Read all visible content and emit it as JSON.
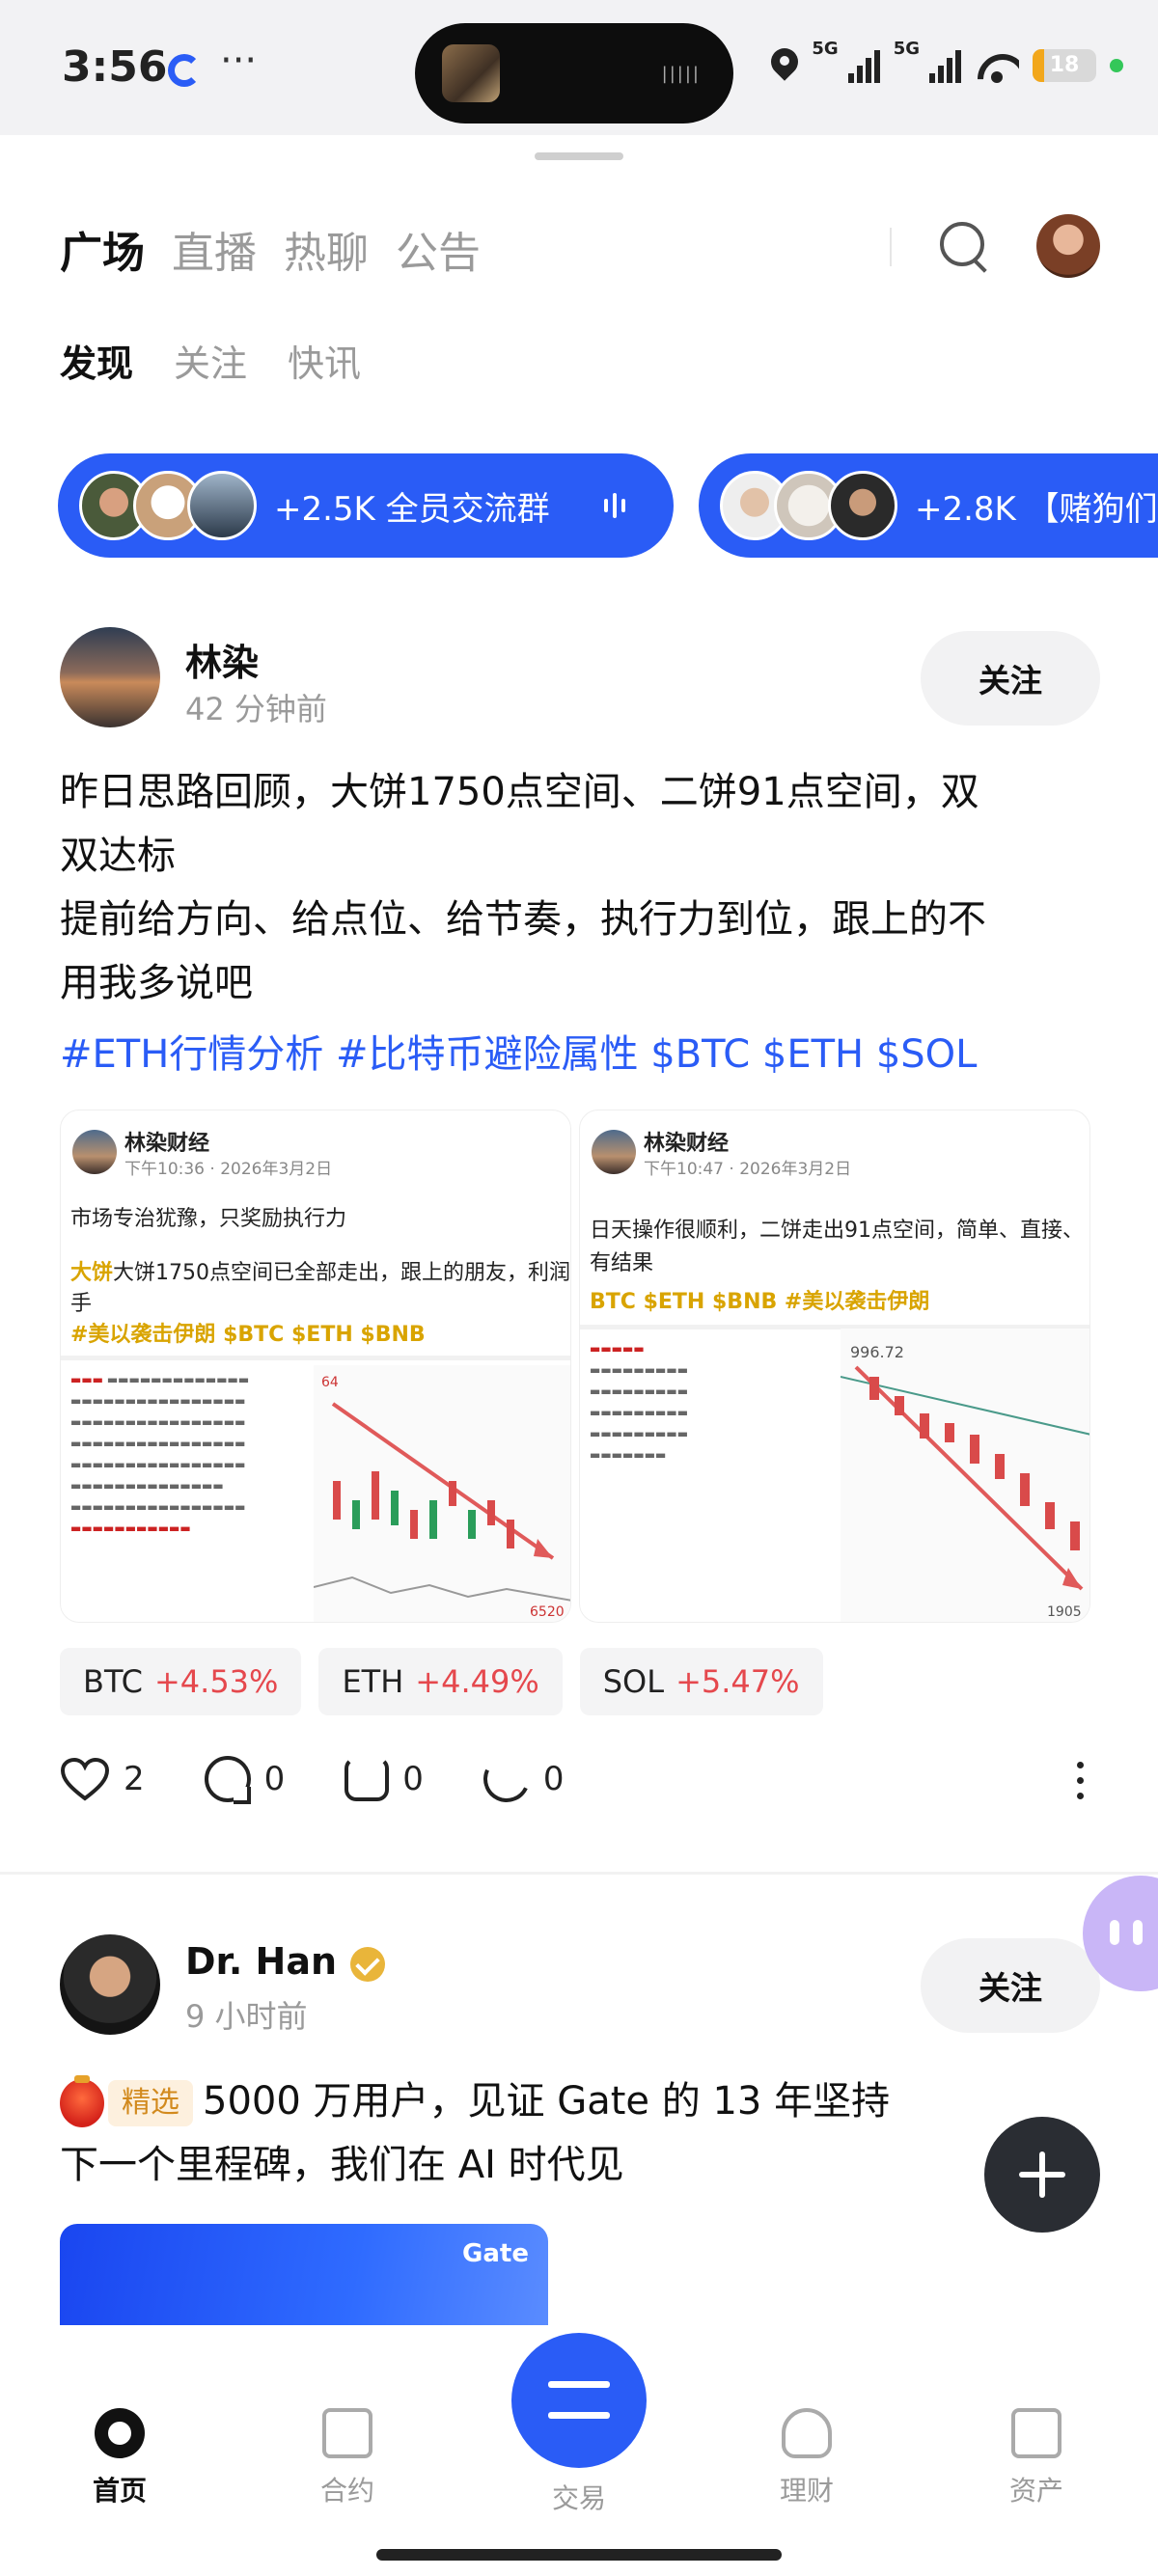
{
  "status_bar": {
    "time": "3:56",
    "network_1": "5G",
    "network_2": "5G",
    "battery_percent": 18
  },
  "top_nav": {
    "tabs": [
      "广场",
      "直播",
      "热聊",
      "公告"
    ],
    "active_tab": 0
  },
  "sub_nav": {
    "tabs": [
      "发现",
      "关注",
      "快讯"
    ],
    "active_tab": 0
  },
  "groups": [
    {
      "label": "+2.5K 全员交流群"
    },
    {
      "label": "+2.8K 【赌狗们的"
    }
  ],
  "post1": {
    "author": "林染",
    "time": "42 分钟前",
    "follow_label": "关注",
    "text_lines": [
      "昨日思路回顾，大饼1750点空间、二饼91点空间，双",
      "双达标",
      "提前给方向、给点位、给节奏，执行力到位，跟上的不",
      "用我多说吧"
    ],
    "hashtags": "#ETH行情分析 #比特币避险属性 $BTC $ETH $SOL",
    "images": [
      {
        "name": "林染财经",
        "date": "下午10:36 · 2026年3月2日",
        "line1": "市场专治犹豫，只奖励执行力",
        "line2": "大饼1750点空间已全部走出，跟上的朋友，利润已到",
        "line3": "手",
        "line4": "#美以袭击伊朗 $BTC $ETH $BNB",
        "chart_label_right": "6520",
        "chart_label_left": "64"
      },
      {
        "name": "林染财经",
        "date": "下午10:47 · 2026年3月2日",
        "line1": "日天操作很顺利，二饼走出91点空间，简单、直接、",
        "line2": "有结果",
        "line3": "BTC $ETH $BNB #美以袭击伊朗",
        "chart_label_top": "996.72",
        "chart_label_bottom": "1905"
      }
    ],
    "tickers": [
      {
        "symbol": "BTC",
        "change": "+4.53%"
      },
      {
        "symbol": "ETH",
        "change": "+4.49%"
      },
      {
        "symbol": "SOL",
        "change": "+5.47%"
      }
    ],
    "likes": "2",
    "comments": "0",
    "reposts": "0",
    "shares": "0"
  },
  "post2": {
    "author": "Dr. Han",
    "time": "9 小时前",
    "follow_label": "关注",
    "badge": "精选",
    "text_line1": "5000 万用户，见证 Gate 的 13 年坚持",
    "text_line2": "下一个里程碑，我们在 AI 时代见",
    "banner_logo": "Gate"
  },
  "tab_bar": {
    "items": [
      "首页",
      "合约",
      "交易",
      "理财",
      "资产"
    ],
    "active": 0
  },
  "colors": {
    "accent": "#2a5cf6",
    "positive_change": "#e5484d",
    "highlight_gold": "#d9a400",
    "fab": "#2a2d33"
  }
}
